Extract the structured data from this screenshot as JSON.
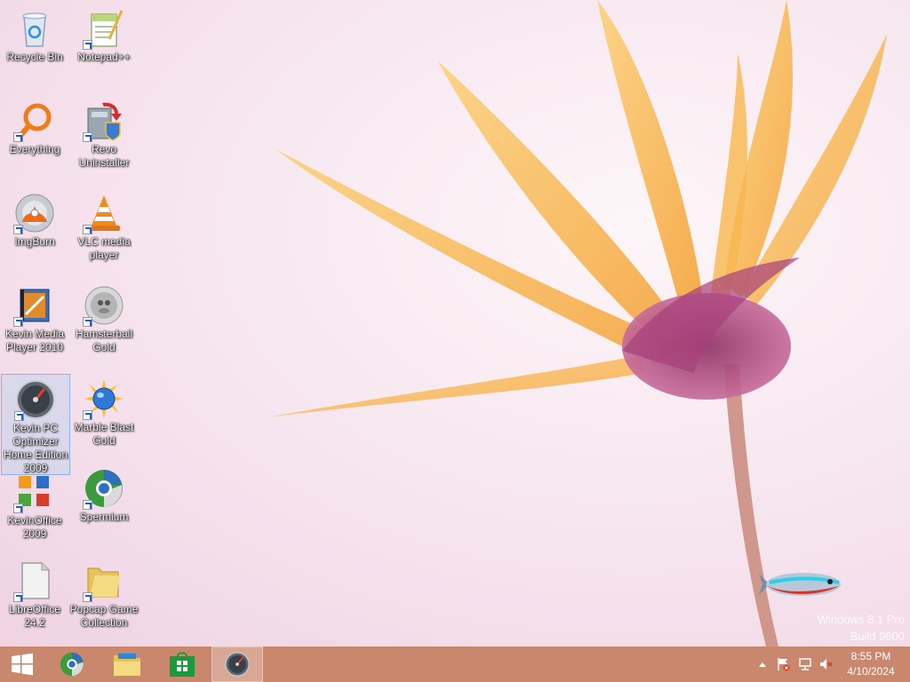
{
  "desktop": {
    "icons": [
      {
        "label": "Recycle Bin",
        "icon": "recycle-bin-icon"
      },
      {
        "label": "Notepad++",
        "icon": "notepad-plus-plus-icon"
      },
      {
        "label": "Everything",
        "icon": "everything-search-icon"
      },
      {
        "label": "Revo Uninstaller",
        "icon": "revo-uninstaller-icon"
      },
      {
        "label": "ImgBurn",
        "icon": "imgburn-icon"
      },
      {
        "label": "VLC media player",
        "icon": "vlc-icon"
      },
      {
        "label": "Kevin Media Player 2010",
        "icon": "media-player-icon"
      },
      {
        "label": "Hamsterball Gold",
        "icon": "hamsterball-icon"
      },
      {
        "label": "Kevin PC Optimizer Home Edition 2009",
        "icon": "pc-optimizer-icon"
      },
      {
        "label": "Marble Blast Gold",
        "icon": "marble-blast-icon"
      },
      {
        "label": "KevinOffice 2009",
        "icon": "office-icon"
      },
      {
        "label": "Spermium",
        "icon": "browser-icon"
      },
      {
        "label": "LibreOffice 24.2",
        "icon": "libreoffice-icon"
      },
      {
        "label": "Popcap Game Collection",
        "icon": "folder-icon"
      }
    ],
    "watermark": {
      "line1": "Windows 8.1 Pro",
      "line2": "Build 9600"
    }
  },
  "taskbar": {
    "color": "#c9876d",
    "buttons": [
      "start-icon",
      "browser-icon",
      "file-explorer-icon",
      "store-icon",
      "pc-optimizer-icon"
    ],
    "clock": {
      "time": "8:55 PM",
      "date": "4/10/2024"
    }
  }
}
